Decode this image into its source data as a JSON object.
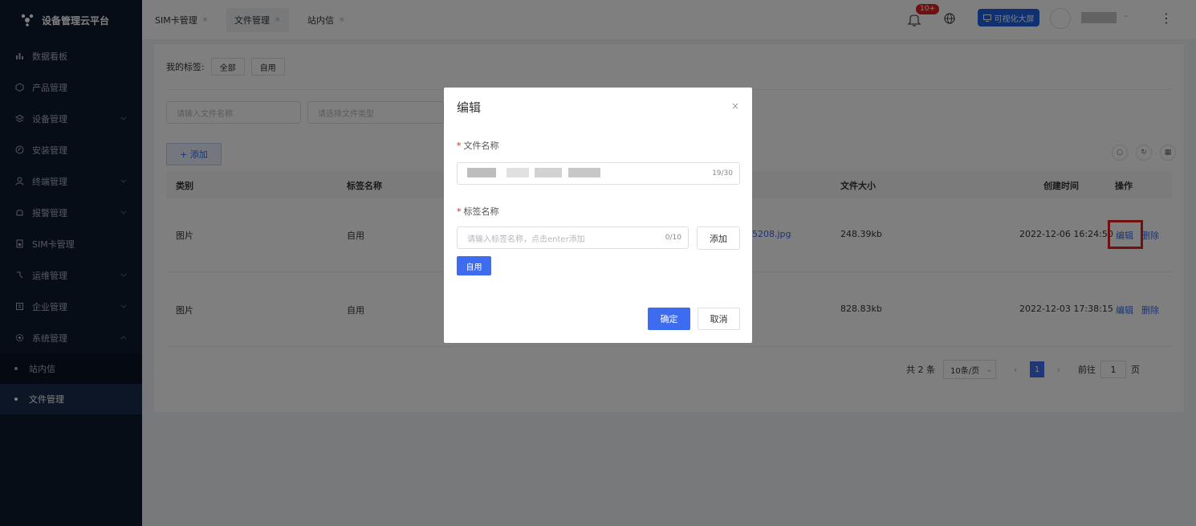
{
  "app": {
    "title": "设备管理云平台"
  },
  "sidebar": {
    "items": [
      {
        "label": "数据看板",
        "icon": "chart-bar-icon"
      },
      {
        "label": "产品管理",
        "icon": "cube-icon"
      },
      {
        "label": "设备管理",
        "icon": "layers-icon"
      },
      {
        "label": "安装管理",
        "icon": "compass-icon"
      },
      {
        "label": "终端管理",
        "icon": "user-icon"
      },
      {
        "label": "报警管理",
        "icon": "alarm-icon"
      },
      {
        "label": "SIM卡管理",
        "icon": "sim-card-icon"
      },
      {
        "label": "运维管理",
        "icon": "tool-icon"
      },
      {
        "label": "企业管理",
        "icon": "building-icon"
      },
      {
        "label": "系统管理",
        "icon": "settings-icon"
      }
    ],
    "sub_items": [
      {
        "label": "站内信"
      },
      {
        "label": "文件管理"
      }
    ]
  },
  "topbar": {
    "tabs": [
      {
        "label": "SIM卡管理",
        "close": "×"
      },
      {
        "label": "文件管理",
        "close": "×"
      },
      {
        "label": "站内信",
        "close": "×"
      }
    ],
    "badge": "10+",
    "bigscreen_label": "可视化大屏",
    "user_caret": "⌄",
    "more": "⋮"
  },
  "toolbar": {
    "my_tags_label": "我的标签:",
    "tag_all": "全部",
    "tag_self": "自用",
    "filename_placeholder": "请输入文件名称",
    "filetype_placeholder": "请选择文件类型",
    "add_label": "+ 添加"
  },
  "table": {
    "headers": {
      "category": "类别",
      "tag_name": "标签名称",
      "file_size": "文件大小",
      "created": "创建时间",
      "actions": "操作"
    },
    "rows": [
      {
        "category": "图片",
        "tag_name": "自用",
        "file_name": "5208.jpg",
        "file_size": "248.39kb",
        "created": "2022-12-06 16:24:50",
        "edit": "编辑",
        "delete": "删除"
      },
      {
        "category": "图片",
        "tag_name": "自用",
        "file_name": "",
        "file_size": "828.83kb",
        "created": "2022-12-03 17:38:15",
        "edit": "编辑",
        "delete": "删除"
      }
    ]
  },
  "pagination": {
    "total": "共 2 条",
    "page_size": "10条/页",
    "current_page": "1",
    "goto_label": "前往",
    "goto_value": "1",
    "page_suffix": "页"
  },
  "dialog": {
    "title": "编辑",
    "close": "×",
    "file_name_label": "文件名称",
    "file_name_count": "19/30",
    "tag_name_label": "标签名称",
    "tag_placeholder": "请输入标签名称，点击enter添加",
    "tag_count": "0/10",
    "add_label": "添加",
    "chip_label": "自用",
    "confirm_label": "确定",
    "cancel_label": "取消"
  },
  "colors": {
    "accent": "#3e6cf0",
    "sidebar_bg": "#0f1b2f",
    "badge": "#e02020",
    "highlight": "#e02020"
  }
}
